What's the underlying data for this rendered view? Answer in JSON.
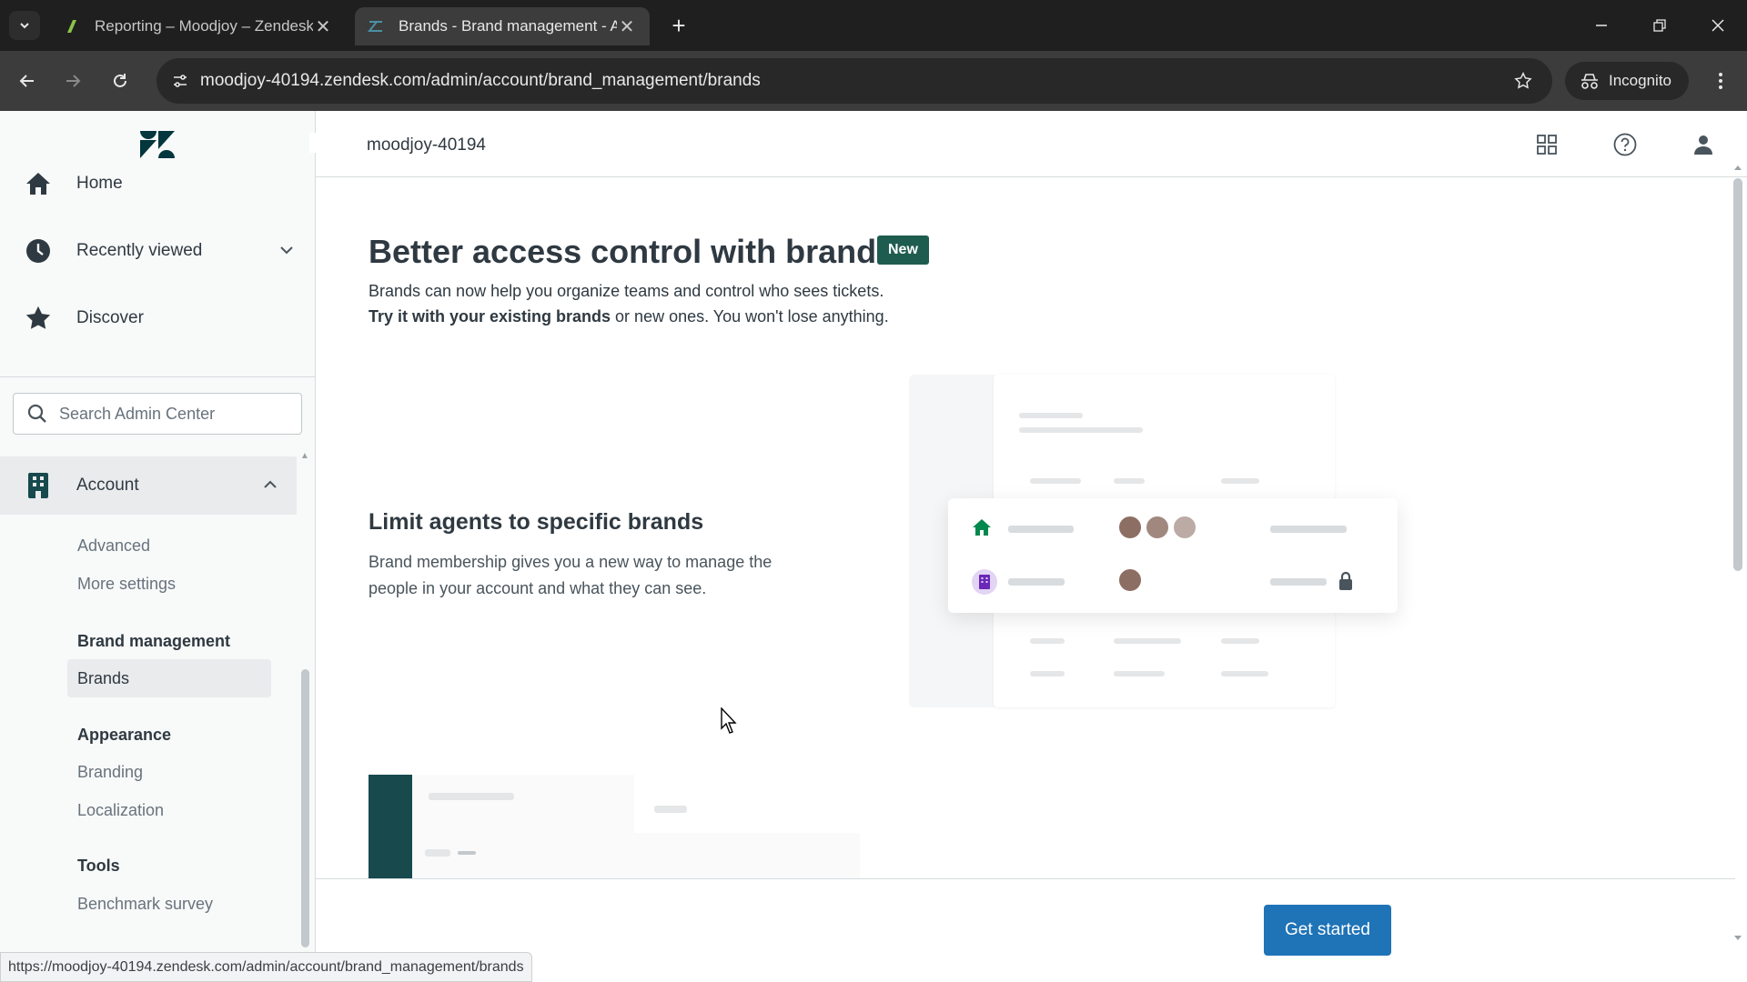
{
  "browser": {
    "tabs": [
      {
        "title": "Reporting – Moodjoy – Zendesk",
        "active": false
      },
      {
        "title": "Brands - Brand management - Admin",
        "active": true
      }
    ],
    "url": "moodjoy-40194.zendesk.com/admin/account/brand_management/brands",
    "incognito_label": "Incognito",
    "status_url": "https://moodjoy-40194.zendesk.com/admin/account/brand_management/brands"
  },
  "sidebar": {
    "nav": [
      {
        "label": "Home",
        "icon": "home-icon"
      },
      {
        "label": "Recently viewed",
        "icon": "clock-icon"
      },
      {
        "label": "Discover",
        "icon": "star-icon"
      }
    ],
    "search_placeholder": "Search Admin Center",
    "account_label": "Account",
    "items": {
      "advanced": "Advanced",
      "more_settings": "More settings",
      "brand_management": "Brand management",
      "brands": "Brands",
      "appearance": "Appearance",
      "branding": "Branding",
      "localization": "Localization",
      "tools": "Tools",
      "benchmark_survey": "Benchmark survey"
    }
  },
  "topbar": {
    "account_name": "moodjoy-40194"
  },
  "main": {
    "title": "Better access control with brands",
    "badge": "New",
    "desc_line1": "Brands can now help you organize teams and control who sees tickets.",
    "desc_bold": "Try it with your existing brands",
    "desc_rest": " or new ones. You won't lose anything.",
    "section_title": "Limit agents to specific brands",
    "section_desc": "Brand membership gives you a new way to manage the people in your account and what they can see.",
    "cta": "Get started"
  },
  "colors": {
    "primary": "#1f73b7",
    "badge": "#1f5c50",
    "brand_green": "#03884e",
    "brand_purple": "#6a27b8"
  }
}
